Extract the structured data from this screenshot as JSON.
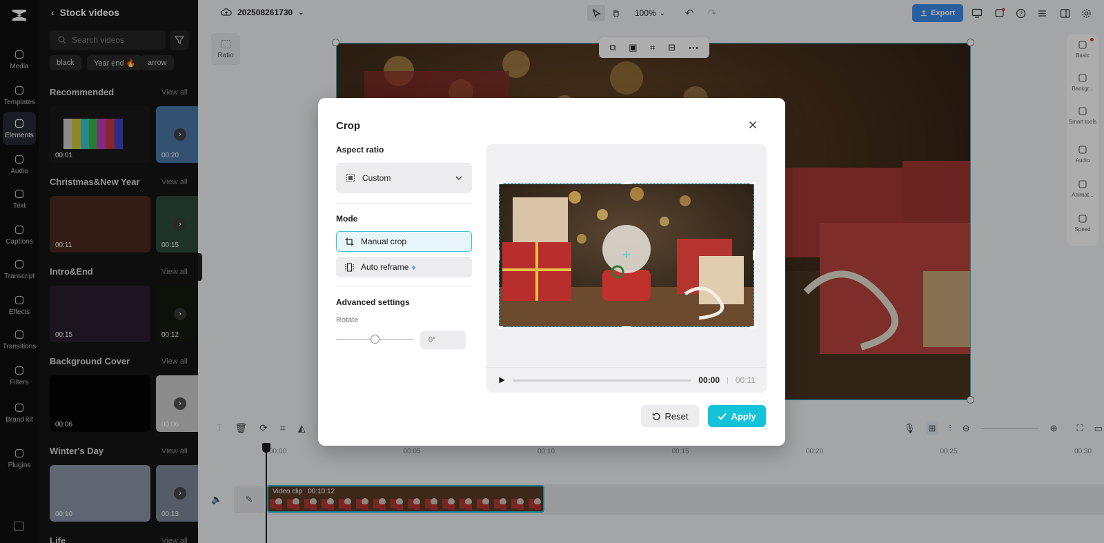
{
  "nav": {
    "items": [
      {
        "label": "Media",
        "icon": "media-icon"
      },
      {
        "label": "Templates",
        "icon": "templates-icon"
      },
      {
        "label": "Elements",
        "icon": "elements-icon",
        "active": true
      },
      {
        "label": "Audio",
        "icon": "audio-icon"
      },
      {
        "label": "Text",
        "icon": "text-icon"
      },
      {
        "label": "Captions",
        "icon": "captions-icon"
      },
      {
        "label": "Transcript",
        "icon": "transcript-icon"
      },
      {
        "label": "Effects",
        "icon": "effects-icon"
      },
      {
        "label": "Transitions",
        "icon": "transitions-icon"
      },
      {
        "label": "Filters",
        "icon": "filters-icon"
      },
      {
        "label": "Brand kit",
        "icon": "brand-kit-icon"
      },
      {
        "label": "Plugins",
        "icon": "plugins-icon"
      }
    ]
  },
  "stock": {
    "title": "Stock videos",
    "search_placeholder": "Search videos",
    "chips": [
      "black",
      "Year end 🔥",
      "arrow"
    ],
    "view_all": "View all",
    "sections": [
      {
        "title": "Recommended",
        "thumbs": [
          "00:01",
          "00:20"
        ]
      },
      {
        "title": "Christmas&New Year",
        "thumbs": [
          "00:11",
          "00:15"
        ]
      },
      {
        "title": "Intro&End",
        "thumbs": [
          "00:15",
          "00:12"
        ]
      },
      {
        "title": "Background Cover",
        "thumbs": [
          "00:06",
          "00:06"
        ]
      },
      {
        "title": "Winter's Day",
        "thumbs": [
          "00:10",
          "00:13"
        ]
      },
      {
        "title": "Life",
        "thumbs": []
      }
    ]
  },
  "topbar": {
    "project_name": "202508261730",
    "zoom": "100%",
    "export_label": "Export"
  },
  "canvas": {
    "ratio_label": "Ratio"
  },
  "right_panel": {
    "items": [
      "Basic",
      "Backgr...",
      "Smart tools",
      "Audio",
      "Animat...",
      "Speed"
    ]
  },
  "timeline": {
    "ruler": [
      "00:00",
      "00:05",
      "00:10",
      "00:15",
      "00:20",
      "00:25",
      "00:30"
    ],
    "clip_label": "Video clip",
    "clip_duration": "00:10:12"
  },
  "crop": {
    "title": "Crop",
    "aspect_ratio_label": "Aspect ratio",
    "aspect_ratio_value": "Custom",
    "mode_label": "Mode",
    "manual_crop": "Manual crop",
    "auto_reframe": "Auto reframe",
    "advanced_label": "Advanced settings",
    "rotate_label": "Rotate",
    "rotate_value": "0°",
    "current_time": "00:00",
    "separator": "|",
    "total_time": "00:11",
    "reset_label": "Reset",
    "apply_label": "Apply"
  },
  "colors": {
    "accent": "#14c2d9",
    "export": "#3b8eea"
  }
}
